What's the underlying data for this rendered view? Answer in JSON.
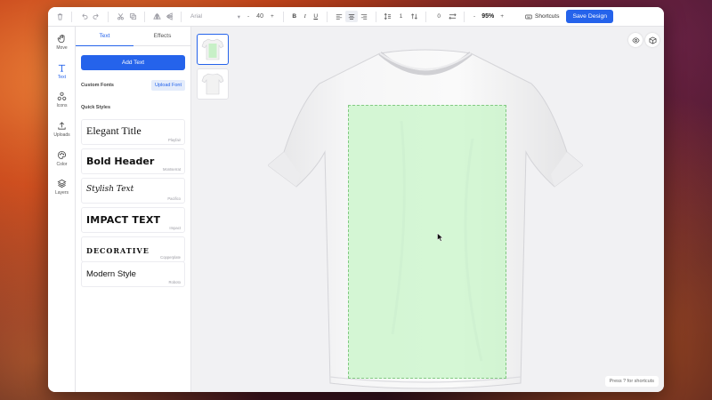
{
  "toolbar": {
    "font_family": "Arial",
    "font_size": "40",
    "font_size_minus": "-",
    "font_size_plus": "+",
    "bold": "B",
    "italic": "I",
    "underline": "U",
    "line_height": "1",
    "letter_spacing": "0",
    "zoom_minus": "-",
    "zoom": "95%",
    "zoom_plus": "+",
    "shortcuts_label": "Shortcuts",
    "save_label": "Save Design"
  },
  "rail": {
    "items": [
      {
        "label": "Move",
        "icon": "hand-icon"
      },
      {
        "label": "Text",
        "icon": "text-icon"
      },
      {
        "label": "Icons",
        "icon": "shapes-icon"
      },
      {
        "label": "Uploads",
        "icon": "upload-icon"
      },
      {
        "label": "Color",
        "icon": "palette-icon"
      },
      {
        "label": "Layers",
        "icon": "layers-icon"
      }
    ],
    "active": "Text"
  },
  "panel": {
    "tabs": [
      {
        "label": "Text",
        "active": true
      },
      {
        "label": "Effects",
        "active": false
      }
    ],
    "add_text_label": "Add Text",
    "custom_fonts_label": "Custom Fonts",
    "upload_font_label": "Upload Font",
    "quick_styles_label": "Quick Styles",
    "quick_styles": [
      {
        "sample": "Elegant Title",
        "font": "Playfair"
      },
      {
        "sample": "Bold Header",
        "font": "Montserrat"
      },
      {
        "sample": "Stylish Text",
        "font": "Pacifico"
      },
      {
        "sample": "IMPACT TEXT",
        "font": "Impact"
      },
      {
        "sample": "DECORATIVE",
        "font": "Copperplate"
      },
      {
        "sample": "Modern Style",
        "font": "Roboto"
      }
    ]
  },
  "canvas": {
    "hint": "Press ? for shortcuts",
    "print_area_color": "#bef5be",
    "shirt_color": "#f7f7f7"
  },
  "colors": {
    "accent": "#2563eb"
  }
}
